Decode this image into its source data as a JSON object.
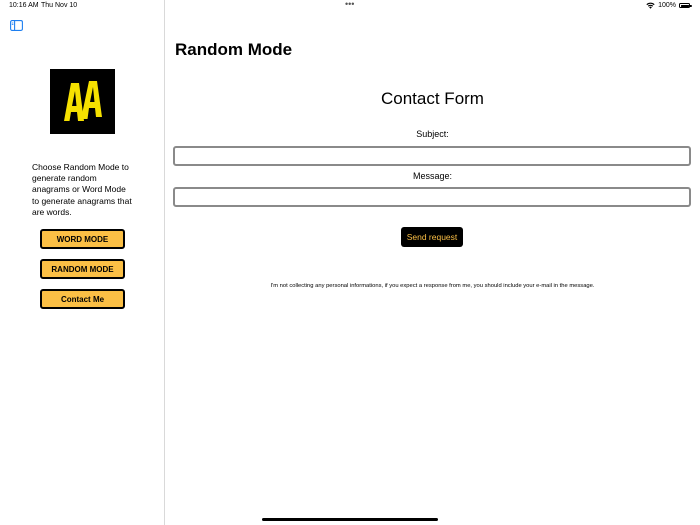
{
  "status_bar": {
    "time": "10:16 AM",
    "date": "Thu Nov 10",
    "battery": "100%",
    "icons": [
      "wifi-icon",
      "battery-icon"
    ]
  },
  "sidebar": {
    "toggle_icon": "sidebar-toggle-icon",
    "logo_text": "AA",
    "description": "Choose Random Mode to generate random anagrams or Word Mode to generate anagrams that are words.",
    "buttons": {
      "word_mode": "WORD MODE",
      "random_mode": "RANDOM MODE",
      "contact_me": "Contact Me"
    }
  },
  "main": {
    "title": "Random Mode",
    "form": {
      "title": "Contact Form",
      "subject_label": "Subject:",
      "subject_value": "",
      "message_label": "Message:",
      "message_value": "",
      "send_label": "Send request"
    },
    "disclaimer": "I'm not collecting any personal informations, if you expect a response from me, you should include your e-mail in the message."
  },
  "colors": {
    "accent": "#fbbf45",
    "input_border": "#8a8a8a",
    "logo_bg": "#000000",
    "logo_letters": "#f6e100"
  }
}
